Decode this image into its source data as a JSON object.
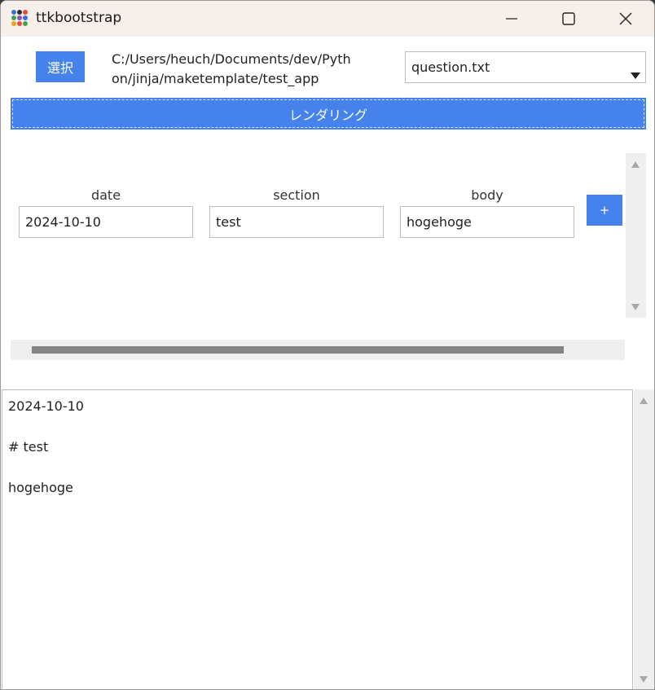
{
  "window": {
    "title": "ttkbootstrap"
  },
  "toolbar": {
    "select_label": "選択",
    "path": "C:/Users/heuch/Documents/dev/Python/jinja/maketemplate/test_app",
    "template_file": "question.txt"
  },
  "render_label": "レンダリング",
  "fields": [
    {
      "label": "date",
      "value": "2024-10-10"
    },
    {
      "label": "section",
      "value": "test"
    },
    {
      "label": "body",
      "value": "hogehoge"
    }
  ],
  "add_label": "+",
  "output": {
    "lines": [
      "2024-10-10",
      "# test",
      "hogehoge"
    ]
  },
  "colors": {
    "accent": "#4582ec",
    "titlebar": "#f7efe9"
  }
}
